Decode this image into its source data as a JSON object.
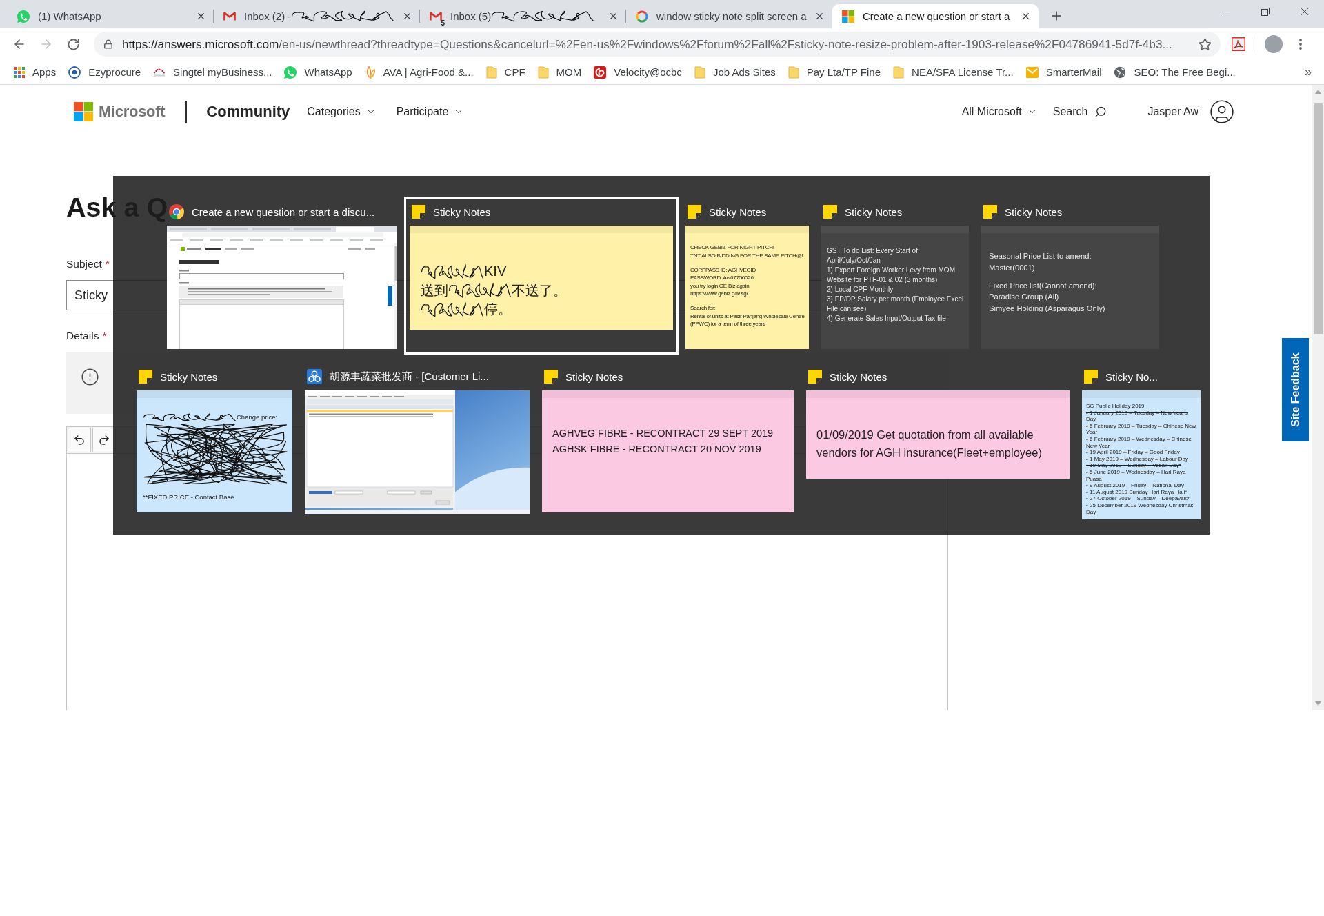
{
  "browser": {
    "tabs": [
      {
        "title": "(1) WhatsApp",
        "selected": false,
        "redacted": false
      },
      {
        "title": "Inbox (2) -",
        "selected": false,
        "redacted": true
      },
      {
        "title": "Inbox (5)",
        "badge": "5",
        "selected": false,
        "redacted": true
      },
      {
        "title": "window sticky note split screen a",
        "selected": false,
        "redacted": false
      },
      {
        "title": "Create a new question or start a",
        "selected": true,
        "redacted": false
      }
    ],
    "back_disabled": false,
    "forward_disabled": true,
    "url": {
      "origin": "https://answers.microsoft.com",
      "rest": "/en-us/newthread?threadtype=Questions&cancelurl=%2Fen-us%2Fwindows%2Fforum%2Fall%2Fsticky-note-resize-problem-after-1903-release%2F04786941-5d7f-4b3..."
    },
    "bookmarks": [
      {
        "label": "Apps",
        "kind": "apps"
      },
      {
        "label": "Ezyprocure",
        "kind": "link"
      },
      {
        "label": "Singtel myBusiness...",
        "kind": "link"
      },
      {
        "label": "WhatsApp",
        "kind": "link"
      },
      {
        "label": "AVA | Agri-Food &...",
        "kind": "link"
      },
      {
        "label": "CPF",
        "kind": "folder"
      },
      {
        "label": "MOM",
        "kind": "folder"
      },
      {
        "label": "Velocity@ocbc",
        "kind": "link"
      },
      {
        "label": "Job Ads Sites",
        "kind": "folder"
      },
      {
        "label": "Pay Lta/TP Fine",
        "kind": "folder"
      },
      {
        "label": "NEA/SFA License Tr...",
        "kind": "folder"
      },
      {
        "label": "SmarterMail",
        "kind": "link"
      },
      {
        "label": "SEO: The Free Begi...",
        "kind": "link"
      }
    ],
    "more_bookmarks": "»"
  },
  "page": {
    "header": {
      "brand": "Microsoft",
      "site": "Community",
      "menus": [
        {
          "label": "Categories"
        },
        {
          "label": "Participate"
        }
      ],
      "all_menu": "All Microsoft",
      "search": "Search",
      "user": "Jasper Aw"
    },
    "heading": "Ask a Q",
    "subject": {
      "label": "Subject",
      "required": "*",
      "value": "Sticky"
    },
    "details": {
      "label": "Details",
      "required": "*"
    },
    "feedback": "Site Feedback"
  },
  "task_view": {
    "rows": [
      {
        "tiles": [
          {
            "kind": "browser",
            "title": "Create a new question or start a discu...",
            "selected": false
          },
          {
            "kind": "note",
            "title": "Sticky Notes",
            "selected": true,
            "color": "#fff2a8",
            "paragraphs": [
              [
                [
                  {
                    "kind": "scribble"
                  },
                  {
                    "kind": "text",
                    "text": "KIV"
                  }
                ],
                [
                  {
                    "kind": "text",
                    "text": "送到"
                  },
                  {
                    "kind": "scribble"
                  },
                  {
                    "kind": "text",
                    "text": "不送了。"
                  }
                ],
                [
                  {
                    "kind": "scribble"
                  },
                  {
                    "kind": "text",
                    "text": "停。"
                  }
                ]
              ]
            ]
          },
          {
            "kind": "note",
            "title": "Sticky Notes",
            "selected": false,
            "color": "#fff2a8",
            "paragraphs": [
              [
                [
                  {
                    "kind": "text",
                    "text": "CHECK GEBIZ FOR NIGHT PITCH!"
                  }
                ],
                [
                  {
                    "kind": "text",
                    "text": "TNT ALSO BIDDING FOR THE SAME PITCH@!"
                  }
                ]
              ],
              [
                [
                  {
                    "kind": "text",
                    "text": "CORPPASS ID: AGHVEGID"
                  }
                ],
                [
                  {
                    "kind": "text",
                    "text": "PASSWORD: Aw67756026"
                  }
                ],
                [
                  {
                    "kind": "text",
                    "text": "you try login GE Biz again"
                  }
                ],
                [
                  {
                    "kind": "text",
                    "text": "https://www.gebiz.gov.sg/"
                  }
                ]
              ],
              [
                [
                  {
                    "kind": "text",
                    "text": "Search for:"
                  }
                ],
                [
                  {
                    "kind": "text",
                    "text": "Rental of units at Pasir Panjang Wholesale Centre (PPWC) for a term of three years"
                  }
                ]
              ]
            ]
          },
          {
            "kind": "note",
            "title": "Sticky Notes",
            "selected": false,
            "color": "#454545",
            "paragraphs": [
              [
                [
                  {
                    "kind": "text",
                    "text": "GST To do List: Every Start of April/July/Oct/Jan"
                  }
                ],
                [
                  {
                    "kind": "text",
                    "text": "1) Export Foreign Worker Levy from MOM Website for PTF-01 & 02 (3 months)"
                  }
                ],
                [
                  {
                    "kind": "text",
                    "text": "2) Local CPF Monthly"
                  }
                ],
                [
                  {
                    "kind": "text",
                    "text": "3) EP/DP Salary per month (Employee Excel File can see)"
                  }
                ],
                [
                  {
                    "kind": "text",
                    "text": "4) Generate Sales Input/Output Tax file"
                  }
                ]
              ]
            ]
          },
          {
            "kind": "note",
            "title": "Sticky Notes",
            "selected": false,
            "color": "#454545",
            "paragraphs": [
              [
                [
                  {
                    "kind": "text",
                    "text": "Seasonal Price List to amend:"
                  }
                ],
                [
                  {
                    "kind": "text",
                    "text": "Master(0001)"
                  }
                ]
              ],
              [
                [
                  {
                    "kind": "text",
                    "text": "Fixed Price list(Cannot amend):"
                  }
                ],
                [
                  {
                    "kind": "text",
                    "text": "Paradise Group (All)"
                  }
                ],
                [
                  {
                    "kind": "text",
                    "text": "Simyee Holding (Asparagus Only)"
                  }
                ]
              ]
            ]
          }
        ]
      },
      {
        "tiles": [
          {
            "kind": "note",
            "title": "Sticky Notes",
            "selected": false,
            "color": "#cce6fb",
            "paragraphs": [
              [
                [
                  {
                    "kind": "scribble"
                  },
                  {
                    "kind": "text",
                    "text": "Change price:"
                  }
                ],
                [
                  {
                    "kind": "scribble_block"
                  }
                ]
              ],
              [
                [
                  {
                    "kind": "text",
                    "text": "**FIXED PRICE - Contact Base"
                  }
                ]
              ]
            ]
          },
          {
            "kind": "app",
            "title": "胡源丰蔬菜批发商 - [Customer Li...",
            "selected": false
          },
          {
            "kind": "note",
            "title": "Sticky Notes",
            "selected": false,
            "color": "#fcc9e3",
            "paragraphs": [
              [
                [
                  {
                    "kind": "text",
                    "text": "AGHVEG FIBRE - RECONTRACT 29 SEPT 2019"
                  }
                ],
                [
                  {
                    "kind": "text",
                    "text": "AGHSK FIBRE - RECONTRACT 20 NOV 2019"
                  }
                ]
              ]
            ]
          },
          {
            "kind": "note",
            "title": "Sticky Notes",
            "selected": false,
            "color": "#fcc9e3",
            "paragraphs": [
              [
                [
                  {
                    "kind": "text",
                    "text": "01/09/2019 Get quotation from all available vendors for AGH insurance(Fleet+employee)"
                  }
                ]
              ]
            ]
          },
          {
            "kind": "note",
            "title": "Sticky No...",
            "selected": false,
            "color": "#cce6fb",
            "paragraphs": [
              [
                [
                  {
                    "kind": "text",
                    "text": "SG Public Holiday 2019",
                    "struck": false
                  }
                ],
                [
                  {
                    "kind": "text",
                    "text": "• 1 January 2019 – Tuesday – New Year's Day",
                    "struck": true
                  }
                ],
                [
                  {
                    "kind": "text",
                    "text": "• 5 February 2019 – Tuesday – Chinese New Year",
                    "struck": true
                  }
                ],
                [
                  {
                    "kind": "text",
                    "text": "• 6 February 2019 – Wednesday – Chinese New Year",
                    "struck": true
                  }
                ],
                [
                  {
                    "kind": "text",
                    "text": "• 19 April 2019 – Friday – Good Friday",
                    "struck": true
                  }
                ],
                [
                  {
                    "kind": "text",
                    "text": "• 1 May 2019 – Wednesday – Labour Day",
                    "struck": true
                  }
                ],
                [
                  {
                    "kind": "text",
                    "text": "• 19 May 2019 – Sunday – Vesak Day*",
                    "struck": true
                  }
                ],
                [
                  {
                    "kind": "text",
                    "text": "• 5 June 2019 – Wednesday – Hari Raya Puasa",
                    "struck": true
                  }
                ],
                [
                  {
                    "kind": "text",
                    "text": "• 9 August 2019 – Friday – National Day",
                    "struck": false
                  }
                ],
                [
                  {
                    "kind": "text",
                    "text": "• 11 August 2019 Sunday Hari Raya Haji^",
                    "struck": false
                  }
                ],
                [
                  {
                    "kind": "text",
                    "text": "• 27 October 2019 – Sunday – Deepavali#",
                    "struck": false
                  }
                ],
                [
                  {
                    "kind": "text",
                    "text": "• 25 December 2019 Wednesday Christmas Day",
                    "struck": false
                  }
                ]
              ]
            ]
          }
        ]
      }
    ]
  }
}
